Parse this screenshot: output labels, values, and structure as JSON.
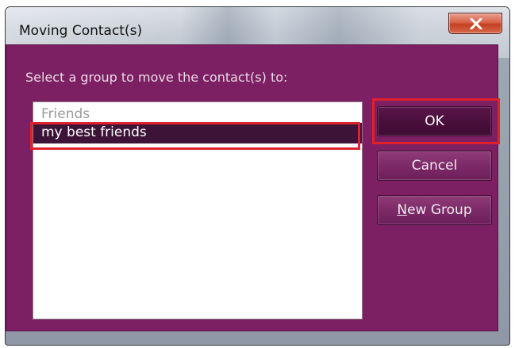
{
  "window": {
    "title": "Moving Contact(s)",
    "close_icon": "close-x-icon"
  },
  "dialog": {
    "prompt": "Select a group to move the contact(s) to:",
    "groups": [
      {
        "label": "Friends",
        "selected": false
      },
      {
        "label": "my best friends",
        "selected": true
      }
    ]
  },
  "buttons": {
    "ok": "OK",
    "cancel": "Cancel",
    "new_group_mnemonic": "N",
    "new_group_rest": "ew Group"
  },
  "colors": {
    "client_background": "#7d1f63",
    "selection": "#3d1438",
    "annotation_highlight": "#e0202a"
  }
}
